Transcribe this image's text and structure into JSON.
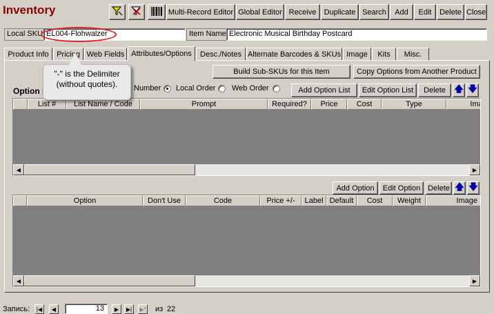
{
  "window": {
    "title": "Inventory"
  },
  "toolbar": {
    "filter_icon": "filter-icon",
    "remove_filter_icon": "remove-filter-icon",
    "barcode_icon": "barcode-icon",
    "buttons": [
      "Multi-Record Editor",
      "Global Editor",
      "Receive",
      "Duplicate",
      "Search",
      "Add",
      "Edit",
      "Delete",
      "Close"
    ]
  },
  "fields": {
    "local_sku_label": "Local SKU",
    "local_sku_value": "EL004-Flohwalzer",
    "item_name_label": "Item Name",
    "item_name_value": "Electronic Musical Birthday Postcard"
  },
  "tabs": [
    "Product Info",
    "Pricing",
    "Web Fields",
    "Attributes/Options",
    "Desc./Notes",
    "Alternate Barcodes & SKUs",
    "Image",
    "Kits",
    "Misc."
  ],
  "active_tab": "Attributes/Options",
  "panel": {
    "build_button": "Build Sub-SKUs for this Item",
    "copy_button": "Copy Options from Another Product",
    "option_label": "Option L",
    "number_label": "Number",
    "radio_local": "Local Order",
    "radio_web": "Web Order",
    "add_list_button": "Add Option List",
    "edit_list_button": "Edit Option List",
    "delete_button_1": "Delete",
    "list_columns": [
      "",
      "List #",
      "List Name / Code",
      "Prompt",
      "Required?",
      "Price",
      "Cost",
      "Type",
      "Image"
    ],
    "add_option_button": "Add Option",
    "edit_option_button": "Edit Option",
    "delete_button_2": "Delete",
    "option_columns": [
      "",
      "Option",
      "Don't Use",
      "Code",
      "Price +/-",
      "Label",
      "Default",
      "Cost",
      "Weight",
      "Image"
    ]
  },
  "callout": {
    "line1": "\"-\" is the Delimiter",
    "line2": "(without quotes)."
  },
  "record_nav": {
    "label": "Запись:",
    "current": "13",
    "of_label": "из",
    "total": "22"
  }
}
